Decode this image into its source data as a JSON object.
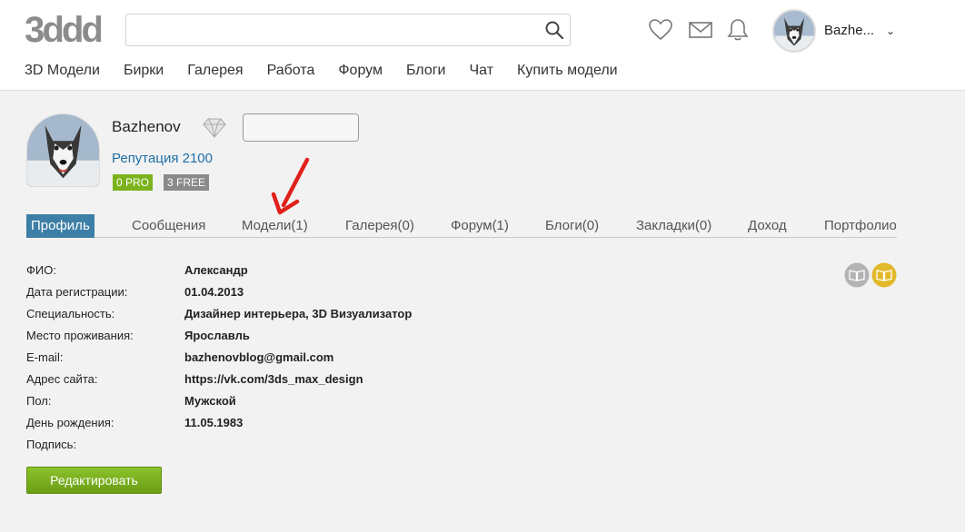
{
  "header": {
    "logo_text": "3ddd",
    "search": {
      "value": "",
      "placeholder": ""
    },
    "icons": [
      "heart-icon",
      "mail-icon",
      "bell-icon",
      "search-icon"
    ],
    "username": "Bazhe...",
    "caret": "⌄"
  },
  "nav": {
    "items": [
      {
        "label": "3D Модели"
      },
      {
        "label": "Бирки"
      },
      {
        "label": "Галерея"
      },
      {
        "label": "Работа"
      },
      {
        "label": "Форум"
      },
      {
        "label": "Блоги"
      },
      {
        "label": "Чат"
      },
      {
        "label": "Купить модели"
      }
    ]
  },
  "profile": {
    "name": "Bazhenov",
    "status_value": "",
    "reputation": "Репутация 2100",
    "badge_pro": "0 PRO",
    "badge_free": "3 FREE"
  },
  "tabs": [
    {
      "label": "Профиль",
      "active": true
    },
    {
      "label": "Сообщения"
    },
    {
      "label": "Модели(1)"
    },
    {
      "label": "Галерея(0)"
    },
    {
      "label": "Форум(1)"
    },
    {
      "label": "Блоги(0)"
    },
    {
      "label": "Закладки(0)"
    },
    {
      "label": "Доход"
    },
    {
      "label": "Портфолио"
    }
  ],
  "info": [
    {
      "label": "ФИО:",
      "value": "Александр"
    },
    {
      "label": "Дата регистрации:",
      "value": "01.04.2013"
    },
    {
      "label": "Специальность:",
      "value": "Дизайнер интерьера, 3D Визуализатор"
    },
    {
      "label": "Место проживания:",
      "value": "Ярославль"
    },
    {
      "label": "E-mail:",
      "value": "bazhenovblog@gmail.com"
    },
    {
      "label": "Адрес сайта:",
      "value": "https://vk.com/3ds_max_design"
    },
    {
      "label": "Пол:",
      "value": "Мужской"
    },
    {
      "label": "День рождения:",
      "value": "11.05.1983"
    },
    {
      "label": "Подпись:",
      "value": ""
    }
  ],
  "edit_button": "Редактировать",
  "colors": {
    "accent_blue": "#3d7fa6",
    "link_blue": "#1f6fa8",
    "pro_green": "#7bb31d",
    "free_gray": "#8a8a8a",
    "button_green": "#7ab11f",
    "arrow_red": "#e0201b",
    "gold": "#e2b92a"
  }
}
